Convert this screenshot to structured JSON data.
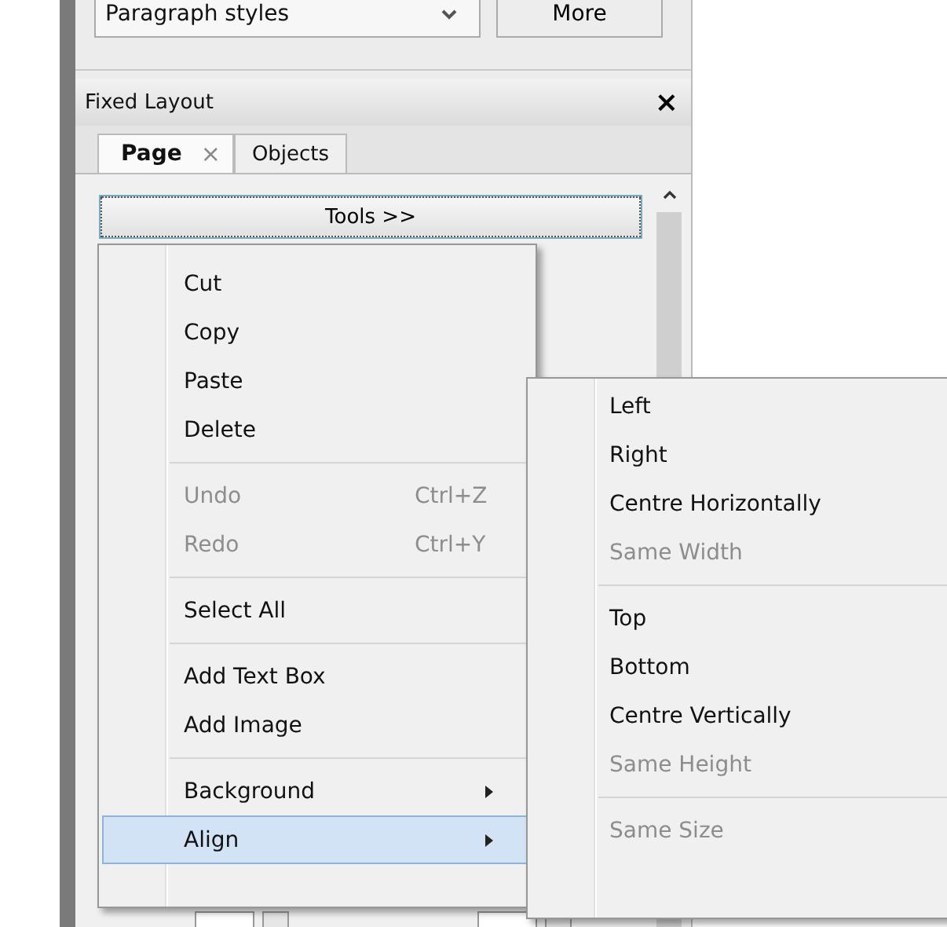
{
  "style_row": {
    "combo": {
      "value": "Paragraph styles"
    },
    "button": "More"
  },
  "panel": {
    "title": "Fixed Layout",
    "close": "×"
  },
  "tabs": [
    {
      "label": "Page",
      "selected": true,
      "close": "×"
    },
    {
      "label": "Objects",
      "selected": false
    }
  ],
  "tools_button": {
    "label": "Tools >>"
  },
  "context_menu": [
    {
      "kind": "item",
      "label": "Cut",
      "disabled": false
    },
    {
      "kind": "item",
      "label": "Copy",
      "disabled": false
    },
    {
      "kind": "item",
      "label": "Paste",
      "disabled": false
    },
    {
      "kind": "item",
      "label": "Delete",
      "disabled": false
    },
    {
      "kind": "separator"
    },
    {
      "kind": "item",
      "label": "Undo",
      "shortcut": "Ctrl+Z",
      "disabled": true
    },
    {
      "kind": "item",
      "label": "Redo",
      "shortcut": "Ctrl+Y",
      "disabled": true
    },
    {
      "kind": "separator"
    },
    {
      "kind": "item",
      "label": "Select All",
      "disabled": false
    },
    {
      "kind": "separator"
    },
    {
      "kind": "item",
      "label": "Add Text Box",
      "disabled": false
    },
    {
      "kind": "item",
      "label": "Add Image",
      "disabled": false
    },
    {
      "kind": "separator"
    },
    {
      "kind": "submenu",
      "label": "Background",
      "disabled": false,
      "selected": false
    },
    {
      "kind": "submenu",
      "label": "Align",
      "disabled": false,
      "selected": true
    }
  ],
  "align_submenu": [
    {
      "kind": "item",
      "label": "Left",
      "disabled": false
    },
    {
      "kind": "item",
      "label": "Right",
      "disabled": false
    },
    {
      "kind": "item",
      "label": "Centre Horizontally",
      "disabled": false
    },
    {
      "kind": "item",
      "label": "Same Width",
      "disabled": true
    },
    {
      "kind": "separator"
    },
    {
      "kind": "item",
      "label": "Top",
      "disabled": false
    },
    {
      "kind": "item",
      "label": "Bottom",
      "disabled": false
    },
    {
      "kind": "item",
      "label": "Centre Vertically",
      "disabled": false
    },
    {
      "kind": "item",
      "label": "Same Height",
      "disabled": true
    },
    {
      "kind": "separator"
    },
    {
      "kind": "item",
      "label": "Same Size",
      "disabled": true
    }
  ]
}
